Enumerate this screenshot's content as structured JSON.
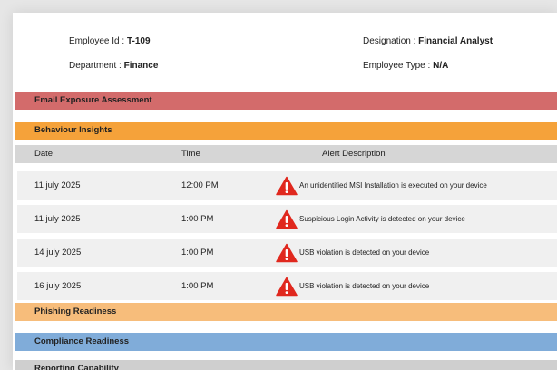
{
  "employee": {
    "id_label": "Employee Id :",
    "id_value": "T-109",
    "designation_label": "Designation :",
    "designation_value": "Financial Analyst",
    "department_label": "Department :",
    "department_value": "Finance",
    "type_label": "Employee Type :",
    "type_value": "N/A"
  },
  "sections": {
    "email": "Email Exposure Assessment",
    "behaviour": "Behaviour Insights",
    "phishing": "Phishing Readiness",
    "compliance": "Compliance Readiness",
    "reporting": "Reporting Capability"
  },
  "colors": {
    "email": "#d36b6b",
    "behaviour": "#f5a23a",
    "phishing": "#f7bd7b",
    "compliance": "#80acd9",
    "reporting": "#cfcfcf",
    "alert_icon": "#e0281e"
  },
  "table": {
    "headers": [
      "Date",
      "Time",
      "Alert Description"
    ],
    "rows": [
      {
        "date": "11 july 2025",
        "time": "12:00 PM",
        "icon": "warning-triangle-icon",
        "description": "An unidentified MSI Installation is executed on your device"
      },
      {
        "date": "11 july 2025",
        "time": "1:00 PM",
        "icon": "warning-triangle-icon",
        "description": "Suspicious Login Activity is detected on your device"
      },
      {
        "date": "14 july 2025",
        "time": "1:00 PM",
        "icon": "warning-triangle-icon",
        "description": "USB violation is detected on your device"
      },
      {
        "date": "16 july 2025",
        "time": "1:00 PM",
        "icon": "warning-triangle-icon",
        "description": "USB violation is detected on your device"
      }
    ]
  }
}
